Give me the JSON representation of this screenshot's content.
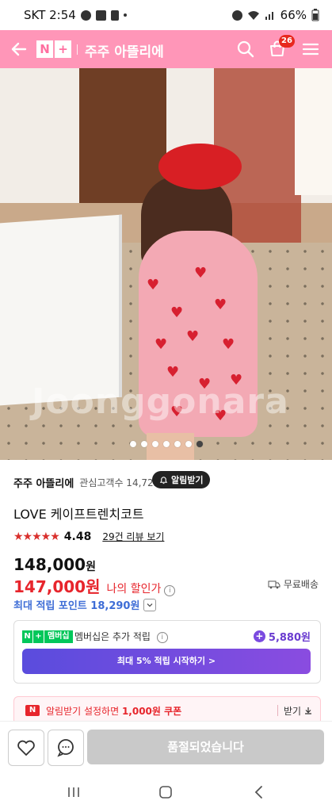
{
  "status_bar": {
    "carrier_time": "SKT 2:54",
    "battery": "66%"
  },
  "header": {
    "nplus_n": "N",
    "nplus_plus": "+",
    "shop_title": "주주 아뜰리에",
    "cart_count": "26"
  },
  "hero": {
    "watermark": "Joonggonara",
    "image_count": 7,
    "active_index": 6
  },
  "store": {
    "name": "주주 아뜰리에",
    "fans": "관심고객수 14,725",
    "alarm_button": "알림받기"
  },
  "product": {
    "title": "LOVE 케이프트렌치코트",
    "rating_score": "4.48",
    "rating_value": 4.48,
    "review_link": "29건 리뷰 보기",
    "original_price": "148,000",
    "original_unit": "원",
    "sale_price": "147,000원",
    "sale_label": "나의 할인가",
    "shipping": "무료배송",
    "points": "최대 적립 포인트 18,290원"
  },
  "membership": {
    "badge_n": "N",
    "badge_plus": "+",
    "badge_text": "멤버십",
    "text": "멤버십은 추가 적립",
    "point": "5,880원",
    "button": "최대 5% 적립 시작하기 >"
  },
  "coupon": {
    "icon": "N",
    "text_prefix": "알림받기 설정하면 ",
    "text_bold": "1,000원 쿠폰",
    "download": "받기"
  },
  "action_bar": {
    "soldout_label": "품절되었습니다"
  },
  "colors": {
    "header_pink": "#ff96b8",
    "sale_red": "#e7252c",
    "points_blue": "#3e6dd6",
    "member_purple": "#6a3cd0"
  }
}
